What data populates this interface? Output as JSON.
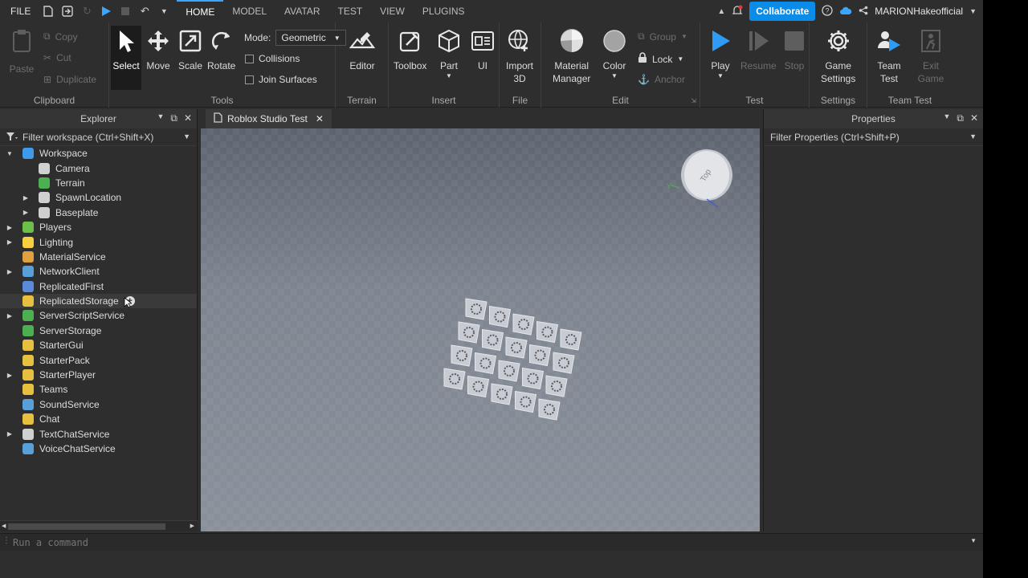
{
  "menubar": {
    "file": "FILE",
    "tabs": [
      {
        "label": "HOME",
        "active": true
      },
      {
        "label": "MODEL",
        "active": false
      },
      {
        "label": "AVATAR",
        "active": false
      },
      {
        "label": "TEST",
        "active": false
      },
      {
        "label": "VIEW",
        "active": false
      },
      {
        "label": "PLUGINS",
        "active": false
      }
    ],
    "collaborate": "Collaborate",
    "username": "MARIONHakeofficial"
  },
  "ribbon": {
    "clipboard": {
      "label": "Clipboard",
      "paste": "Paste",
      "copy": "Copy",
      "cut": "Cut",
      "duplicate": "Duplicate"
    },
    "tools": {
      "label": "Tools",
      "select": "Select",
      "move": "Move",
      "scale": "Scale",
      "rotate": "Rotate",
      "mode_label": "Mode:",
      "mode_value": "Geometric",
      "collisions": "Collisions",
      "join_surfaces": "Join Surfaces"
    },
    "terrain": {
      "label": "Terrain",
      "editor": "Editor"
    },
    "insert": {
      "label": "Insert",
      "toolbox": "Toolbox",
      "part": "Part",
      "ui": "UI"
    },
    "file": {
      "label": "File",
      "import_line1": "Import",
      "import_line2": "3D"
    },
    "edit": {
      "label": "Edit",
      "material_line1": "Material",
      "material_line2": "Manager",
      "color": "Color",
      "group": "Group",
      "lock": "Lock",
      "anchor": "Anchor"
    },
    "test": {
      "label": "Test",
      "play": "Play",
      "resume": "Resume",
      "stop": "Stop"
    },
    "settings": {
      "label": "Settings",
      "game_line1": "Game",
      "game_line2": "Settings"
    },
    "team_test": {
      "label": "Team Test",
      "team_line1": "Team",
      "team_line2": "Test",
      "exit_line1": "Exit",
      "exit_line2": "Game"
    }
  },
  "explorer": {
    "title": "Explorer",
    "filter": "Filter workspace (Ctrl+Shift+X)",
    "items": [
      {
        "label": "Workspace",
        "indent": 0,
        "toggle": "open",
        "color": "#3d9be9"
      },
      {
        "label": "Camera",
        "indent": 1,
        "toggle": "none",
        "color": "#d0d0d0"
      },
      {
        "label": "Terrain",
        "indent": 1,
        "toggle": "none",
        "color": "#4caf50"
      },
      {
        "label": "SpawnLocation",
        "indent": 1,
        "toggle": "closed",
        "color": "#d0d0d0"
      },
      {
        "label": "Baseplate",
        "indent": 1,
        "toggle": "closed",
        "color": "#d0d0d0"
      },
      {
        "label": "Players",
        "indent": 0,
        "toggle": "closed",
        "color": "#6cc04a"
      },
      {
        "label": "Lighting",
        "indent": 0,
        "toggle": "closed",
        "color": "#f5d142"
      },
      {
        "label": "MaterialService",
        "indent": 0,
        "toggle": "none",
        "color": "#e0a040"
      },
      {
        "label": "NetworkClient",
        "indent": 0,
        "toggle": "closed",
        "color": "#5aa0d8"
      },
      {
        "label": "ReplicatedFirst",
        "indent": 0,
        "toggle": "none",
        "color": "#5a8ad8"
      },
      {
        "label": "ReplicatedStorage",
        "indent": 0,
        "toggle": "none",
        "color": "#e8c040",
        "hover": true
      },
      {
        "label": "ServerScriptService",
        "indent": 0,
        "toggle": "closed",
        "color": "#4caf50"
      },
      {
        "label": "ServerStorage",
        "indent": 0,
        "toggle": "none",
        "color": "#4caf50"
      },
      {
        "label": "StarterGui",
        "indent": 0,
        "toggle": "none",
        "color": "#e8c040"
      },
      {
        "label": "StarterPack",
        "indent": 0,
        "toggle": "none",
        "color": "#e8c040"
      },
      {
        "label": "StarterPlayer",
        "indent": 0,
        "toggle": "closed",
        "color": "#e8c040"
      },
      {
        "label": "Teams",
        "indent": 0,
        "toggle": "none",
        "color": "#e8c040"
      },
      {
        "label": "SoundService",
        "indent": 0,
        "toggle": "none",
        "color": "#5aa0d8"
      },
      {
        "label": "Chat",
        "indent": 0,
        "toggle": "none",
        "color": "#e8c040"
      },
      {
        "label": "TextChatService",
        "indent": 0,
        "toggle": "closed",
        "color": "#d0d0d0"
      },
      {
        "label": "VoiceChatService",
        "indent": 0,
        "toggle": "none",
        "color": "#5aa0d8"
      }
    ]
  },
  "viewport": {
    "tab_title": "Roblox Studio Test",
    "gizmo_label": "Top",
    "gizmo_axis": "Y"
  },
  "properties": {
    "title": "Properties",
    "filter": "Filter Properties (Ctrl+Shift+P)"
  },
  "command_bar": {
    "placeholder": "Run a command"
  }
}
